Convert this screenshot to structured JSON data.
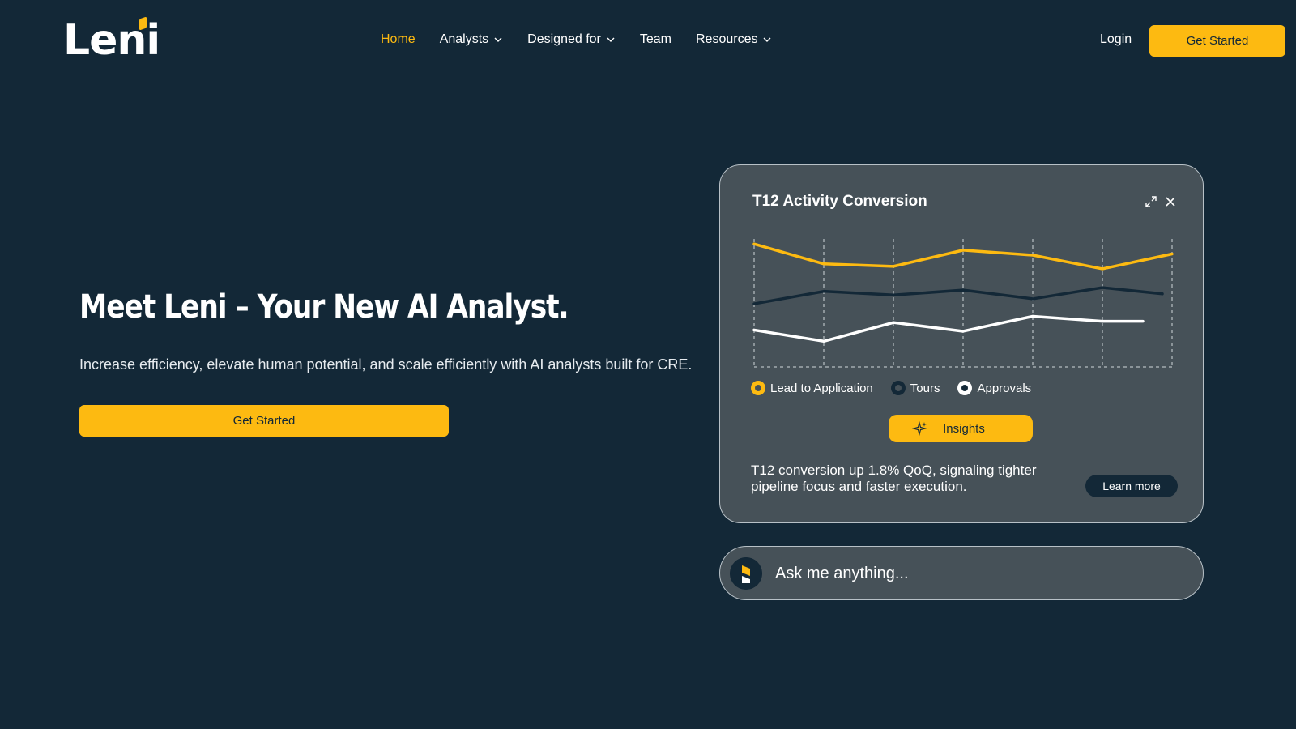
{
  "brand": {
    "logo_text": "Leni",
    "colors": {
      "background": "#132837",
      "accent": "#FDBA11",
      "card": "#465158",
      "series_yellow": "#FDBA11",
      "series_dark": "#132837",
      "series_white": "#FFFFFF"
    }
  },
  "nav": {
    "items": [
      {
        "label": "Home",
        "active": true,
        "dropdown": false
      },
      {
        "label": "Analysts",
        "active": false,
        "dropdown": true
      },
      {
        "label": "Designed for",
        "active": false,
        "dropdown": true
      },
      {
        "label": "Team",
        "active": false,
        "dropdown": false
      },
      {
        "label": "Resources",
        "active": false,
        "dropdown": true
      }
    ],
    "login_label": "Login",
    "cta_label": "Get Started"
  },
  "hero": {
    "title": "Meet Leni – Your New AI Analyst.",
    "subtitle": "Increase efficiency, elevate human potential, and scale efficiently with AI analysts built for CRE.",
    "cta_label": "Get Started"
  },
  "card": {
    "title": "T12 Activity Conversion",
    "icons": [
      "expand-icon",
      "close-icon"
    ],
    "insights_label": "Insights",
    "insight_text": "T12 conversion up 1.8% QoQ, signaling tighter pipeline focus and faster execution.",
    "learn_more_label": "Learn more"
  },
  "chart_data": {
    "type": "line",
    "x": [
      0,
      1,
      2,
      3,
      4,
      5,
      6
    ],
    "ylim": [
      0,
      100
    ],
    "grid": "vertical-dashed",
    "legend_position": "bottom",
    "series": [
      {
        "name": "Lead to Application",
        "color": "#FDBA11",
        "values": [
          96,
          80,
          78,
          91,
          87,
          76,
          88
        ]
      },
      {
        "name": "Tours",
        "color": "#132837",
        "values": [
          48,
          58,
          55,
          59,
          52,
          61,
          56
        ]
      },
      {
        "name": "Approvals",
        "color": "#FFFFFF",
        "values": [
          27,
          18,
          33,
          26,
          38,
          34,
          34
        ]
      }
    ]
  },
  "ask": {
    "placeholder": "Ask me anything...",
    "avatar_icon": "leni-avatar-icon"
  }
}
